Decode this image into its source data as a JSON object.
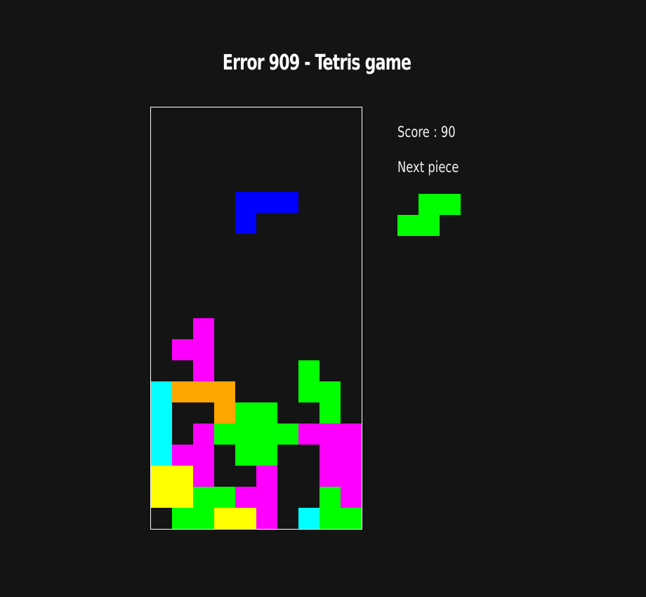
{
  "title": "Error 909 - Tetris game",
  "score": {
    "label": "Score :",
    "value": "90"
  },
  "next_piece": {
    "label": "Next piece",
    "color": "#00ff00",
    "cells": [
      [
        0,
        1
      ],
      [
        0,
        2
      ],
      [
        1,
        0
      ],
      [
        1,
        1
      ]
    ]
  },
  "colors": {
    "background": "#141414",
    "board_border": "#ffffff",
    "blue": "#0000ff",
    "magenta": "#ff00ff",
    "green": "#00ff00",
    "cyan": "#00ffff",
    "orange": "#ffa500",
    "yellow": "#ffff00"
  },
  "board": {
    "cols": 10,
    "rows": 20,
    "falling_piece": {
      "color": "blue",
      "cells": [
        [
          4,
          4
        ],
        [
          4,
          5
        ],
        [
          4,
          6
        ],
        [
          5,
          4
        ]
      ]
    },
    "locked_cells": [
      [
        10,
        2,
        "magenta"
      ],
      [
        11,
        1,
        "magenta"
      ],
      [
        11,
        2,
        "magenta"
      ],
      [
        12,
        2,
        "magenta"
      ],
      [
        12,
        7,
        "green"
      ],
      [
        13,
        0,
        "cyan"
      ],
      [
        13,
        1,
        "orange"
      ],
      [
        13,
        2,
        "orange"
      ],
      [
        13,
        3,
        "orange"
      ],
      [
        13,
        7,
        "green"
      ],
      [
        13,
        8,
        "green"
      ],
      [
        14,
        0,
        "cyan"
      ],
      [
        14,
        3,
        "orange"
      ],
      [
        14,
        4,
        "green"
      ],
      [
        14,
        5,
        "green"
      ],
      [
        14,
        8,
        "green"
      ],
      [
        15,
        0,
        "cyan"
      ],
      [
        15,
        2,
        "magenta"
      ],
      [
        15,
        3,
        "green"
      ],
      [
        15,
        4,
        "green"
      ],
      [
        15,
        5,
        "green"
      ],
      [
        15,
        6,
        "green"
      ],
      [
        15,
        7,
        "magenta"
      ],
      [
        15,
        8,
        "magenta"
      ],
      [
        15,
        9,
        "magenta"
      ],
      [
        16,
        0,
        "cyan"
      ],
      [
        16,
        1,
        "magenta"
      ],
      [
        16,
        2,
        "magenta"
      ],
      [
        16,
        4,
        "green"
      ],
      [
        16,
        5,
        "green"
      ],
      [
        16,
        8,
        "magenta"
      ],
      [
        16,
        9,
        "magenta"
      ],
      [
        17,
        0,
        "yellow"
      ],
      [
        17,
        1,
        "yellow"
      ],
      [
        17,
        2,
        "magenta"
      ],
      [
        17,
        5,
        "magenta"
      ],
      [
        17,
        8,
        "magenta"
      ],
      [
        17,
        9,
        "magenta"
      ],
      [
        18,
        0,
        "yellow"
      ],
      [
        18,
        1,
        "yellow"
      ],
      [
        18,
        2,
        "green"
      ],
      [
        18,
        3,
        "green"
      ],
      [
        18,
        4,
        "magenta"
      ],
      [
        18,
        5,
        "magenta"
      ],
      [
        18,
        8,
        "green"
      ],
      [
        18,
        9,
        "magenta"
      ],
      [
        19,
        1,
        "green"
      ],
      [
        19,
        2,
        "green"
      ],
      [
        19,
        3,
        "yellow"
      ],
      [
        19,
        4,
        "yellow"
      ],
      [
        19,
        5,
        "magenta"
      ],
      [
        19,
        7,
        "cyan"
      ],
      [
        19,
        8,
        "green"
      ],
      [
        19,
        9,
        "green"
      ]
    ]
  }
}
